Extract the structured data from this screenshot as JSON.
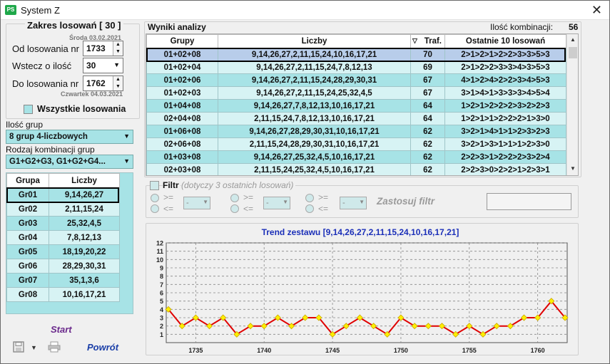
{
  "window": {
    "title": "System Z",
    "icon": "PS"
  },
  "range": {
    "title": "Zakres losowań  [ 30 ]",
    "from_date": "Środa 03.02.2021",
    "from_label": "Od losowania nr",
    "from_value": "1733",
    "back_label": "Wstecz o ilość",
    "back_value": "30",
    "to_label": "Do losowania nr",
    "to_value": "1762",
    "to_date": "Czwartek 04.03.2021",
    "all_label": "Wszystkie losowania"
  },
  "groups_count": {
    "label": "Ilość grup",
    "value": "8 grup 4-liczbowych"
  },
  "combo_kind": {
    "label": "Rodzaj kombinacji grup",
    "value": "G1+G2+G3, G1+G2+G4..."
  },
  "groups_table": {
    "headers": [
      "Grupa",
      "Liczby"
    ],
    "rows": [
      [
        "Gr01",
        "9,14,26,27"
      ],
      [
        "Gr02",
        "2,11,15,24"
      ],
      [
        "Gr03",
        "25,32,4,5"
      ],
      [
        "Gr04",
        "7,8,12,13"
      ],
      [
        "Gr05",
        "18,19,20,22"
      ],
      [
        "Gr06",
        "28,29,30,31"
      ],
      [
        "Gr07",
        "35,1,3,6"
      ],
      [
        "Gr08",
        "10,16,17,21"
      ]
    ]
  },
  "actions": {
    "start": "Start",
    "back": "Powrót"
  },
  "results": {
    "title": "Wyniki analizy",
    "count_label": "Ilość kombinacji:",
    "count_value": "56",
    "headers": [
      "Grupy",
      "Liczby",
      "Traf.",
      "Ostatnie 10 losowań"
    ],
    "rows": [
      [
        "01+02+08",
        "9,14,26,27,2,11,15,24,10,16,17,21",
        "70",
        "2>1>2>1>2>2>3>3>5>3"
      ],
      [
        "01+02+04",
        "9,14,26,27,2,11,15,24,7,8,12,13",
        "69",
        "2>1>2>2>3>3>4>3>5>3"
      ],
      [
        "01+02+06",
        "9,14,26,27,2,11,15,24,28,29,30,31",
        "67",
        "4>1>2>4>2>2>3>4>5>3"
      ],
      [
        "01+02+03",
        "9,14,26,27,2,11,15,24,25,32,4,5",
        "67",
        "3>1>4>1>3>3>3>4>5>4"
      ],
      [
        "01+04+08",
        "9,14,26,27,7,8,12,13,10,16,17,21",
        "64",
        "1>2>1>2>2>2>3>2>2>3"
      ],
      [
        "02+04+08",
        "2,11,15,24,7,8,12,13,10,16,17,21",
        "64",
        "1>2>1>1>2>2>2>1>3>0"
      ],
      [
        "01+06+08",
        "9,14,26,27,28,29,30,31,10,16,17,21",
        "62",
        "3>2>1>4>1>1>2>3>2>3"
      ],
      [
        "02+06+08",
        "2,11,15,24,28,29,30,31,10,16,17,21",
        "62",
        "3>2>1>3>1>1>1>2>3>0"
      ],
      [
        "01+03+08",
        "9,14,26,27,25,32,4,5,10,16,17,21",
        "62",
        "2>2>3>1>2>2>2>3>2>4"
      ],
      [
        "02+03+08",
        "2,11,15,24,25,32,4,5,10,16,17,21",
        "62",
        "2>2>3>0>2>2>1>2>3>1"
      ]
    ]
  },
  "filter": {
    "label": "Filtr",
    "note": "(dotyczy 3 ostatnich losowań)",
    "ge": ">=",
    "le": "<=",
    "dash": "-",
    "apply": "Zastosuj filtr"
  },
  "chart_data": {
    "type": "line",
    "title": "Trend zestawu [9,14,26,27,2,11,15,24,10,16,17,21]",
    "x": [
      1733,
      1734,
      1735,
      1736,
      1737,
      1738,
      1739,
      1740,
      1741,
      1742,
      1743,
      1744,
      1745,
      1746,
      1747,
      1748,
      1749,
      1750,
      1751,
      1752,
      1753,
      1754,
      1755,
      1756,
      1757,
      1758,
      1759,
      1760,
      1761,
      1762
    ],
    "values": [
      4,
      2,
      3,
      2,
      3,
      1,
      2,
      2,
      3,
      2,
      3,
      3,
      1,
      2,
      3,
      2,
      1,
      3,
      2,
      2,
      2,
      1,
      2,
      1,
      2,
      2,
      3,
      3,
      5,
      3
    ],
    "ylim": [
      0,
      12
    ],
    "xticks": [
      1735,
      1740,
      1745,
      1750,
      1755,
      1760
    ],
    "yticks": [
      1,
      2,
      3,
      4,
      5,
      6,
      7,
      8,
      9,
      10,
      11,
      12
    ],
    "grid": true,
    "line_color": "#e00000",
    "marker_color": "#ffee00"
  }
}
